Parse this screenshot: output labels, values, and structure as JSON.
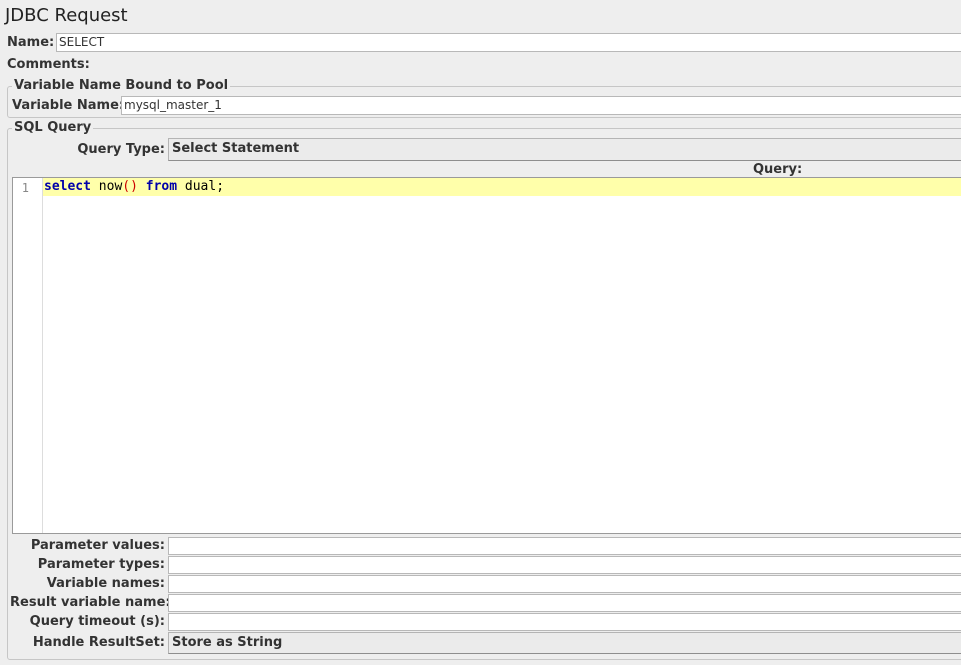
{
  "panel": {
    "title": "JDBC Request"
  },
  "name": {
    "label": "Name:",
    "value": "SELECT"
  },
  "comments": {
    "label": "Comments:",
    "value": ""
  },
  "pool": {
    "legend": "Variable Name Bound to Pool",
    "label": "Variable Name:",
    "value": "mysql_master_1"
  },
  "sql": {
    "legend": "SQL Query",
    "query_type_label": "Query Type:",
    "query_type_value": "Select Statement",
    "query_label": "Query:",
    "editor": {
      "line_number": "1",
      "tokens": {
        "kw1": "select",
        "sp1": " ",
        "fn": "now",
        "parens": "()",
        "sp2": " ",
        "kw2": "from",
        "rest": " dual;"
      }
    },
    "params": [
      {
        "label": "Parameter values:",
        "value": ""
      },
      {
        "label": "Parameter types:",
        "value": ""
      },
      {
        "label": "Variable names:",
        "value": ""
      },
      {
        "label": "Result variable name:",
        "value": ""
      },
      {
        "label": "Query timeout (s):",
        "value": ""
      }
    ],
    "handle_resultset_label": "Handle ResultSet:",
    "handle_resultset_value": "Store as String"
  }
}
